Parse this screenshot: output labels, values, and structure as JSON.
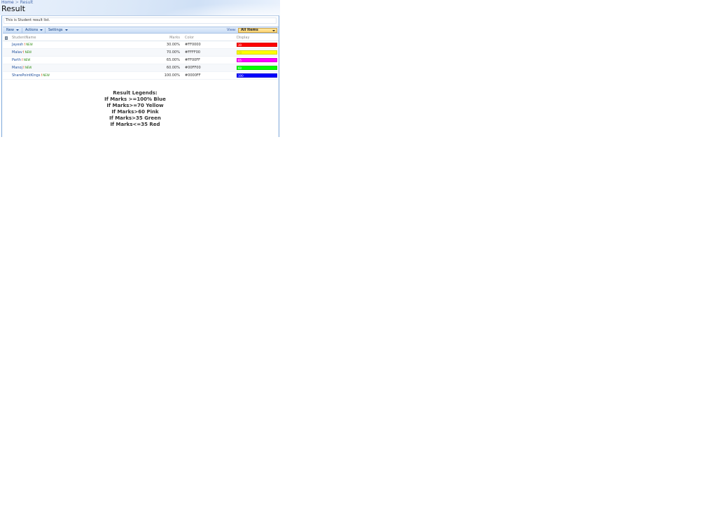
{
  "breadcrumb": {
    "home": "Home",
    "separator": ">",
    "current": "Result"
  },
  "page": {
    "title": "Result"
  },
  "list": {
    "description": "This is Student result list."
  },
  "toolbar": {
    "new_label": "New",
    "actions_label": "Actions",
    "settings_label": "Settings",
    "view_label": "View:",
    "view_selected": "All Items"
  },
  "grid": {
    "headers": {
      "name": "StudentName",
      "marks": "Marks",
      "color": "Color",
      "display": "Display"
    },
    "new_badge": "NEW",
    "rows": [
      {
        "name": "Jayesh",
        "marks": "30.00%",
        "color": "#FF0000",
        "display": "30",
        "fill": "#FF0000",
        "text_color": "#ffffff"
      },
      {
        "name": "Malav",
        "marks": "70.00%",
        "color": "#FFFF00",
        "display": "70",
        "fill": "#FFFF00",
        "text_color": "#c8c800"
      },
      {
        "name": "Parth",
        "marks": "65.00%",
        "color": "#FF00FF",
        "display": "65",
        "fill": "#FF00FF",
        "text_color": "#ffffff"
      },
      {
        "name": "Manoj",
        "marks": "60.00%",
        "color": "#00FF00",
        "display": "60",
        "fill": "#00FF00",
        "text_color": "#ffffff"
      },
      {
        "name": "SharePointKings",
        "marks": "100.00%",
        "color": "#0000FF",
        "display": "100",
        "fill": "#0000FF",
        "text_color": "#ffffff"
      }
    ]
  },
  "legend": {
    "title": "Result Legends:",
    "lines": [
      "If Marks >=100% Blue",
      "If Marks>=70 Yellow",
      "If Marks>60 Pink",
      "If Marks>35 Green",
      "If Marks<=35 Red"
    ]
  },
  "colors": {
    "header_bg": "#dbe8f8",
    "toolbar_bg": "#c9dcf5",
    "link": "#1f4f9c",
    "frame_border": "#7da7d9"
  }
}
